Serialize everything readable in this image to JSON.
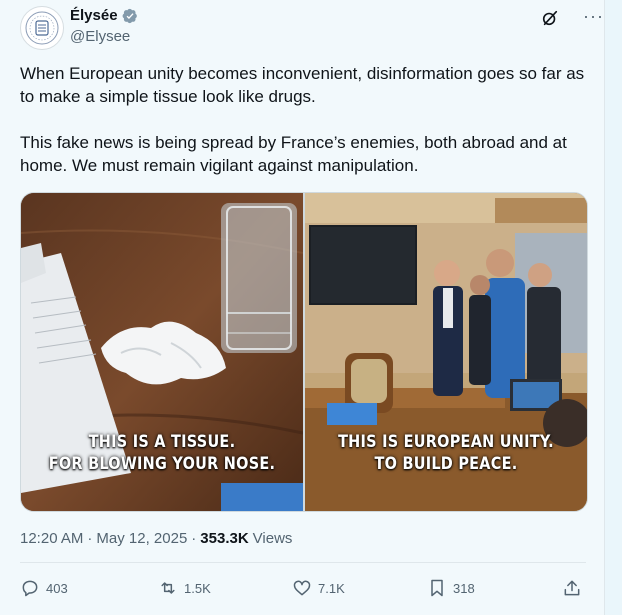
{
  "author": {
    "name": "Élysée",
    "handle": "@Elysee"
  },
  "post": {
    "paragraphs": [
      "When European unity becomes inconvenient, disinformation goes so far as to make a simple tissue look like drugs.",
      "This fake news is being spread by France’s enemies, both abroad and at home. We must remain vigilant against manipulation."
    ],
    "media": {
      "left_caption": [
        "THIS IS A TISSUE.",
        "FOR BLOWING YOUR NOSE."
      ],
      "right_caption": [
        "THIS IS EUROPEAN UNITY.",
        "TO BUILD PEACE."
      ]
    },
    "time": "12:20 AM",
    "separator": "·",
    "date": "May 12, 2025",
    "views_count": "353.3K",
    "views_label": "Views"
  },
  "actions": {
    "replies": "403",
    "reposts": "1.5K",
    "likes": "7.1K",
    "bookmarks": "318"
  },
  "colors": {
    "verified": "#1d9bf0",
    "muted": "#536471",
    "background": "#f2f9fc"
  },
  "icons": [
    "verified-badge-icon",
    "grok-icon",
    "more-icon",
    "reply-icon",
    "repost-icon",
    "like-icon",
    "bookmark-icon",
    "share-icon"
  ]
}
